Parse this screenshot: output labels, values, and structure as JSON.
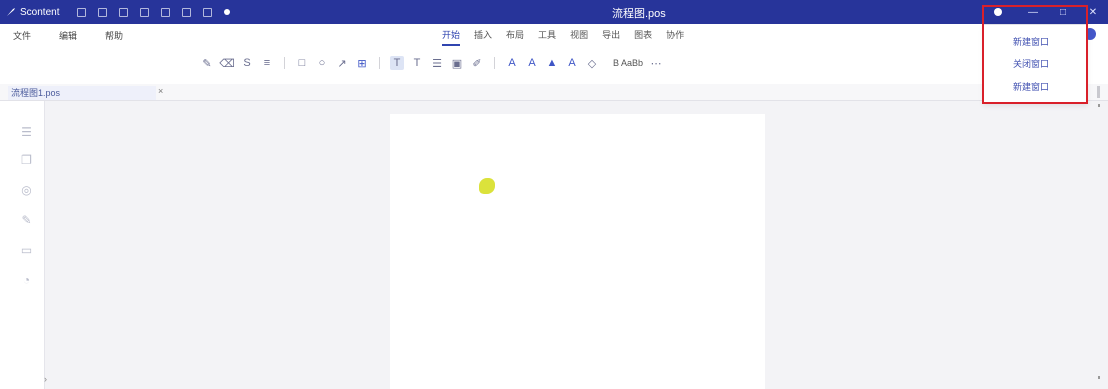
{
  "titlebar": {
    "app_name": "Scontent",
    "doc_title": "流程图.pos",
    "controls": [
      "—",
      "□",
      "✕"
    ]
  },
  "menu": {
    "left_items": [
      "文件",
      "编辑",
      "帮助"
    ],
    "tabs": [
      "开始",
      "插入",
      "布局",
      "工具",
      "视图",
      "导出",
      "图表",
      "协作"
    ],
    "active_tab_index": 0
  },
  "toolbar": {
    "text_button": "B AaBb"
  },
  "document_tab": {
    "label": "流程图1.pos",
    "close_label": "×"
  },
  "dropdown": {
    "items": [
      "新建窗口",
      "关闭窗口",
      "新建窗口"
    ]
  },
  "sidebar": {
    "icons": [
      "outline-icon",
      "pages-icon",
      "shapes-icon",
      "brush-icon",
      "comment-icon",
      "history-icon"
    ]
  }
}
